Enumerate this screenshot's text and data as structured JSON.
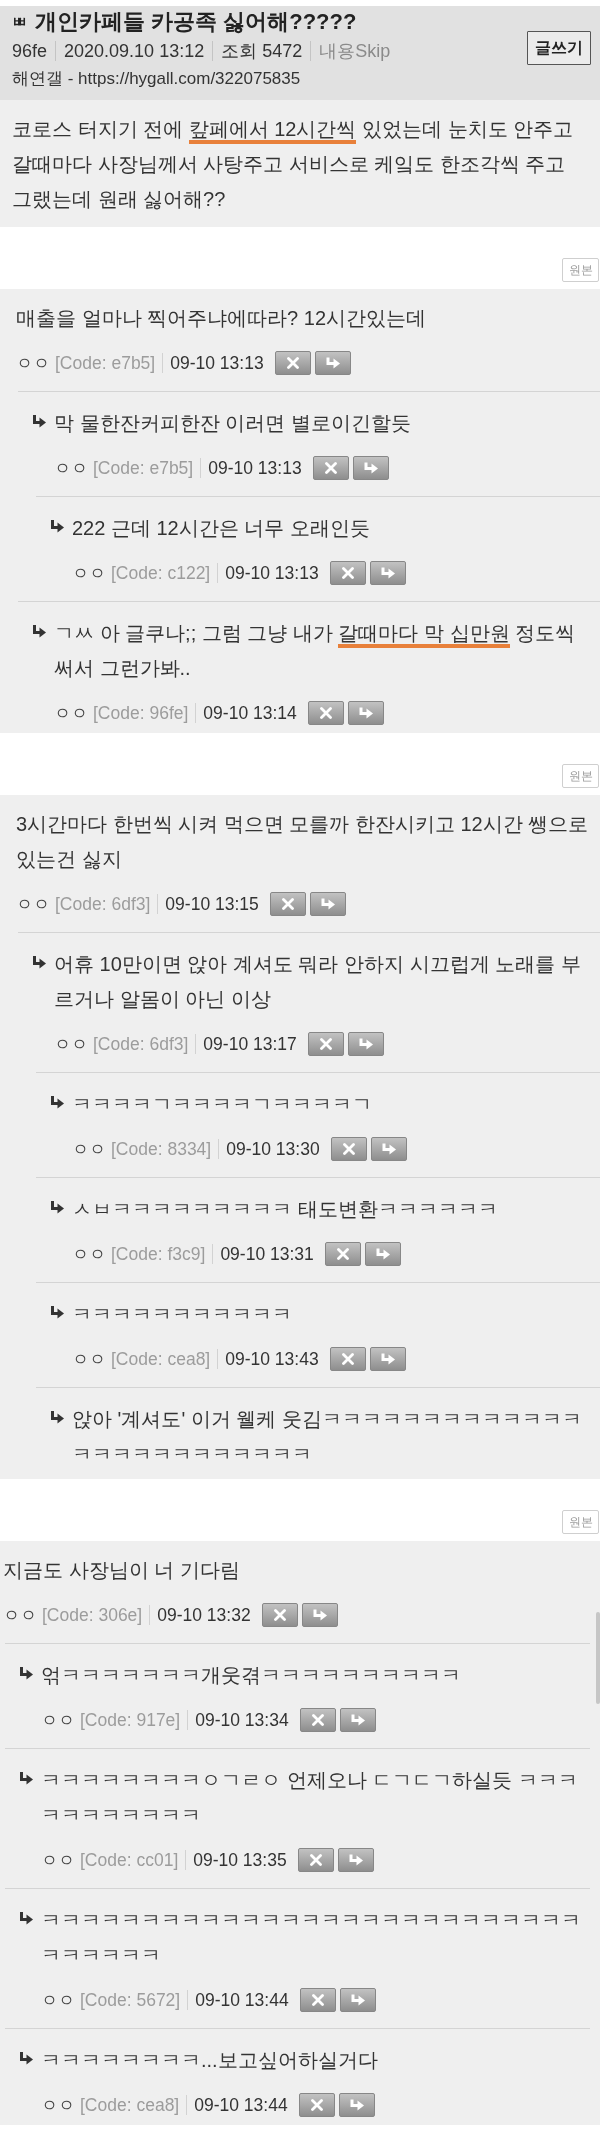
{
  "post": {
    "category": "ㅃ",
    "title": "개인카페들 카공족 싫어해?????",
    "author_code": "96fe",
    "date": "2020.09.10 13:12",
    "views": "조회 5472",
    "skip_link": "내용Skip",
    "source": "해연갤 - https://hygall.com/322075835",
    "write_button": "글쓰기",
    "body": [
      {
        "text": "코로스 터지기 전에 ",
        "underlined": false
      },
      {
        "text": "캎페에서 12시간씩",
        "underlined": true
      },
      {
        "text": " 있었는데 눈치도 안주고 갈때마다 사장님께서 사탕주고 서비스로 케잌도 한조각씩 주고 그랬는데 원래 싫어해??",
        "underlined": false
      }
    ]
  },
  "threads": [
    {
      "original_button": "원본",
      "comment": {
        "text": "매출을 얼마나 찍어주냐에따라? 12시간있는데",
        "author": "ㅇㅇ",
        "code": "[Code: e7b5]",
        "time": "09-10 13:13",
        "children": [
          {
            "text": "막 물한잔커피한잔 이러면 별로이긴할듯",
            "author": "ㅇㅇ",
            "code": "[Code: e7b5]",
            "time": "09-10 13:13",
            "children": [
              {
                "text": "222 근데 12시간은 너무 오래인듯",
                "author": "ㅇㅇ",
                "code": "[Code: c122]",
                "time": "09-10 13:13"
              }
            ]
          },
          {
            "text_parts": [
              {
                "text": "ㄱㅆ 아 글쿠나;; 그럼 그냥 내가 ",
                "underlined": false
              },
              {
                "text": "갈때마다 막 십만원",
                "underlined": true
              },
              {
                "text": " 정도씩 써서 그런가봐..",
                "underlined": false
              }
            ],
            "author": "ㅇㅇ",
            "code": "[Code: 96fe]",
            "time": "09-10 13:14"
          }
        ]
      }
    },
    {
      "original_button": "원본",
      "comment": {
        "text": "3시간마다 한번씩 시켜 먹으면 모를까 한잔시키고 12시간 쌩으로 있는건 싫지",
        "author": "ㅇㅇ",
        "code": "[Code: 6df3]",
        "time": "09-10 13:15",
        "children": [
          {
            "text": "어휴 10만이면 앉아 계셔도 뭐라 안하지 시끄럽게 노래를 부르거나 알몸이 아닌 이상",
            "author": "ㅇㅇ",
            "code": "[Code: 6df3]",
            "time": "09-10 13:17",
            "children": [
              {
                "text": "ㅋㅋㅋㅋㄱㅋㅋㅋㅋㄱㅋㅋㅋㅋㄱ",
                "author": "ㅇㅇ",
                "code": "[Code: 8334]",
                "time": "09-10 13:30"
              },
              {
                "text": "ㅅㅂㅋㅋㅋㅋㅋㅋㅋㅋㅋ 태도변환ㅋㅋㅋㅋㅋㅋ",
                "author": "ㅇㅇ",
                "code": "[Code: f3c9]",
                "time": "09-10 13:31"
              },
              {
                "text": "ㅋㅋㅋㅋㅋㅋㅋㅋㅋㅋㅋ",
                "author": "ㅇㅇ",
                "code": "[Code: cea8]",
                "time": "09-10 13:43"
              },
              {
                "text": "앉아 '계셔도' 이거 웰케 웃김ㅋㅋㅋㅋㅋㅋㅋㅋㅋㅋㅋㅋㅋㅋㅋㅋㅋㅋㅋㅋㅋㅋㅋㅋㅋ"
              }
            ]
          }
        ]
      }
    },
    {
      "original_button": "원본",
      "comment": {
        "text": "지금도 사장님이 너 기다림",
        "author": "ㅇㅇ",
        "code": "[Code: 306e]",
        "time": "09-10 13:32",
        "children": [
          {
            "text": "얶ㅋㅋㅋㅋㅋㅋㅋ개웃겪ㅋㅋㅋㅋㅋㅋㅋㅋㅋㅋ",
            "author": "ㅇㅇ",
            "code": "[Code: 917e]",
            "time": "09-10 13:34"
          },
          {
            "text": "ㅋㅋㅋㅋㅋㅋㅋㅋㅇㄱㄹㅇ 언제오나 ㄷㄱㄷㄱ하실듯 ㅋㅋㅋㅋㅋㅋㅋㅋㅋㅋㅋ",
            "author": "ㅇㅇ",
            "code": "[Code: cc01]",
            "time": "09-10 13:35"
          },
          {
            "text": "ㅋㅋㅋㅋㅋㅋㅋㅋㅋㅋㅋㅋㅋㅋㅋㅋㅋㅋㅋㅋㅋㅋㅋㅋㅋㅋㅋㅋㅋㅋㅋㅋㅋ",
            "author": "ㅇㅇ",
            "code": "[Code: 5672]",
            "time": "09-10 13:44"
          },
          {
            "text": "ㅋㅋㅋㅋㅋㅋㅋㅋ...보고싶어하실거다",
            "author": "ㅇㅇ",
            "code": "[Code: cea8]",
            "time": "09-10 13:44"
          }
        ]
      }
    }
  ]
}
